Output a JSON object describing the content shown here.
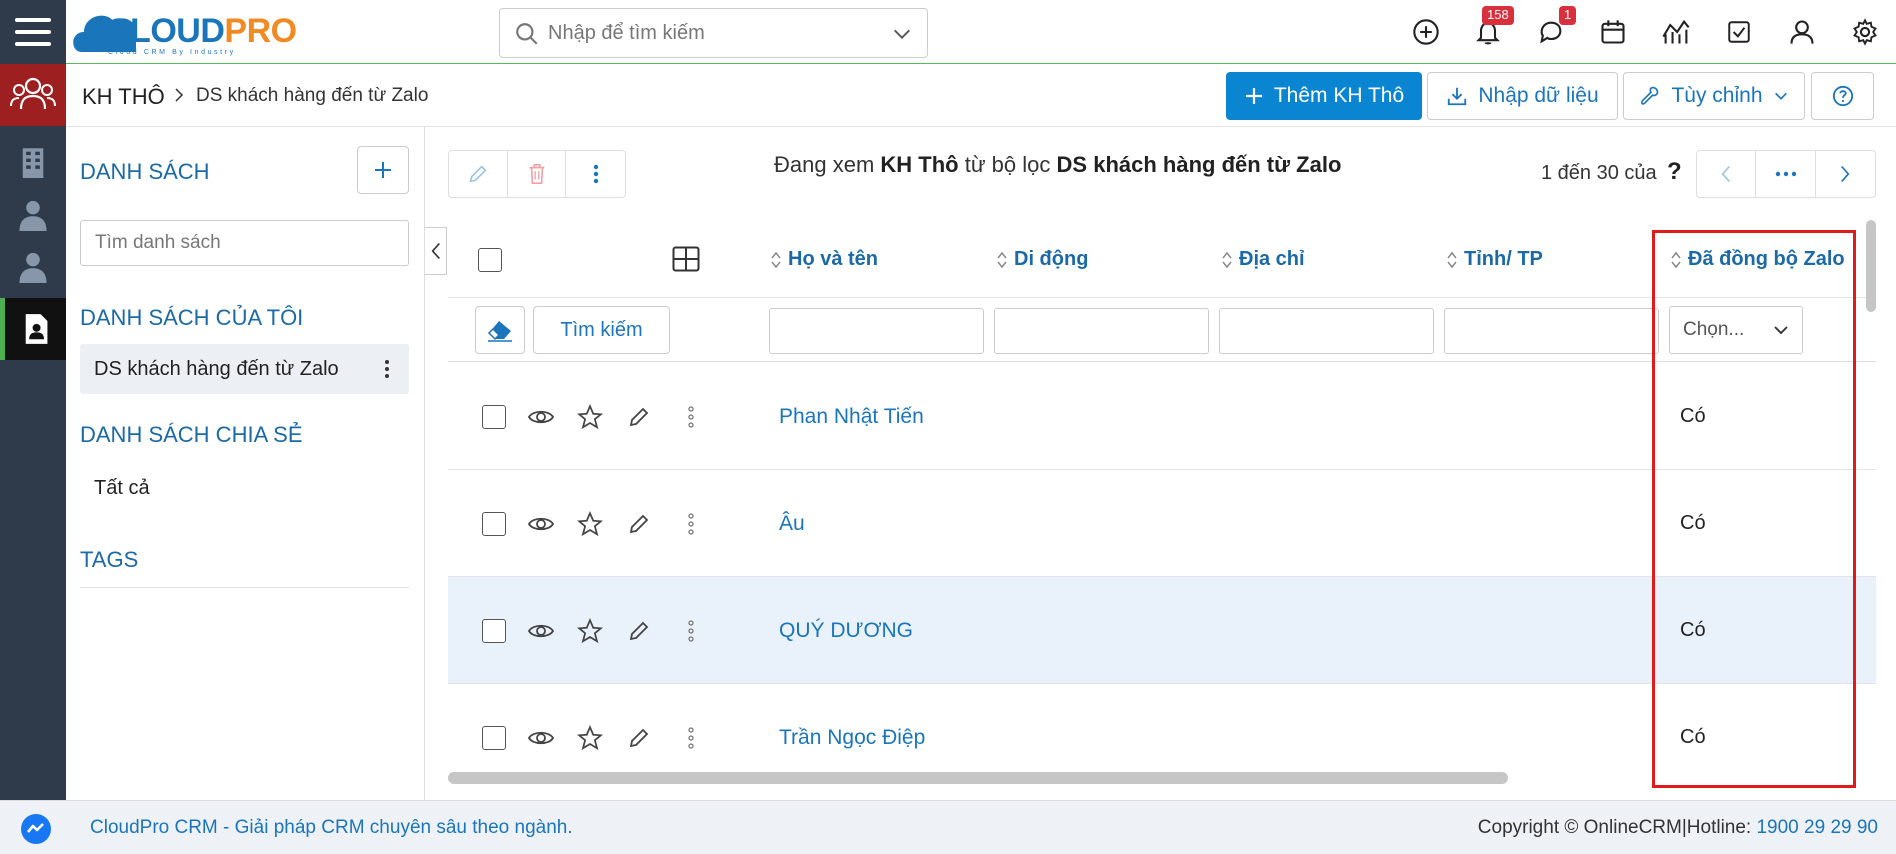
{
  "app": {
    "logo_text_cloud": "CLOUD",
    "logo_text_pro": "PRO",
    "logo_tagline": "Cloud CRM By Industry"
  },
  "topbar": {
    "search_placeholder": "Nhập để tìm kiếm",
    "notifications_badge": "158",
    "messages_badge": "1"
  },
  "breadcrumb": {
    "module": "KH THÔ",
    "page": "DS khách hàng đến từ Zalo"
  },
  "actions": {
    "add_label": "Thêm KH Thô",
    "import_label": "Nhập dữ liệu",
    "customize_label": "Tùy chỉnh"
  },
  "sidebar": {
    "title": "DANH SÁCH",
    "search_placeholder": "Tìm danh sách",
    "my_lists_title": "DANH SÁCH CỦA TÔI",
    "my_lists": [
      {
        "label": "DS khách hàng đến từ Zalo"
      }
    ],
    "shared_title": "DANH SÁCH CHIA SẺ",
    "shared_lists": [
      {
        "label": "Tất cả"
      }
    ],
    "tags_title": "TAGS"
  },
  "main": {
    "viewing_prefix": "Đang xem",
    "viewing_module": "KH Thô",
    "viewing_middle": "từ bộ lọc",
    "viewing_filter": "DS khách hàng đến từ Zalo",
    "pager_text": "1 đến 30 của",
    "pager_q": "?"
  },
  "table": {
    "columns": [
      "Họ và tên",
      "Di động",
      "Địa chỉ",
      "Tỉnh/ TP",
      "Đã đồng bộ Zalo"
    ],
    "search_button": "Tìm kiếm",
    "select_placeholder": "Chọn...",
    "rows": [
      {
        "name": "Phan Nhật Tiến",
        "zalo": "Có"
      },
      {
        "name": "Âu",
        "zalo": "Có"
      },
      {
        "name": "QUÝ DƯƠNG",
        "zalo": "Có"
      },
      {
        "name": "Trần Ngọc Điệp",
        "zalo": "Có"
      }
    ]
  },
  "footer": {
    "left_text": "CloudPro CRM - Giải pháp CRM chuyên sâu theo ngành.",
    "copyright": "Copyright © OnlineCRM|Hotline:",
    "hotline": "1900 29 29 90"
  },
  "colors": {
    "brand_blue": "#1b75bb",
    "primary_button": "#0a85d1",
    "nav_bg": "#2f3b4a",
    "highlight_red": "#e01b1b",
    "badge_red": "#d9303e"
  }
}
